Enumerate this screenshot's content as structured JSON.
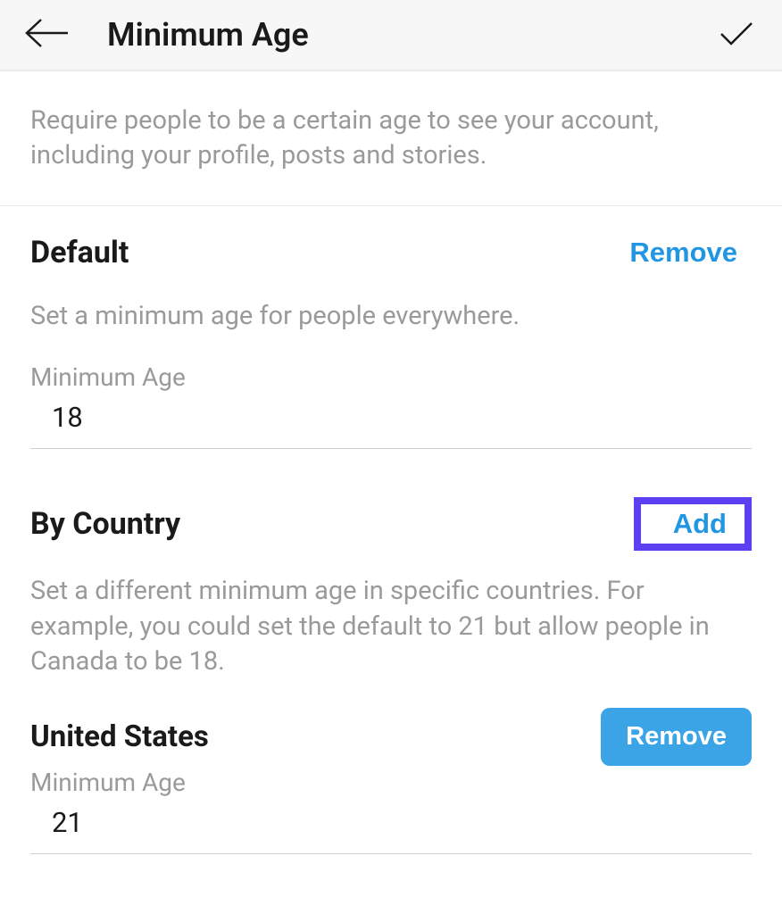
{
  "header": {
    "title": "Minimum Age"
  },
  "description": "Require people to be a certain age to see your account, including your profile, posts and stories.",
  "default_section": {
    "title": "Default",
    "remove_label": "Remove",
    "description": "Set a minimum age for people everywhere.",
    "field_label": "Minimum Age",
    "field_value": "18"
  },
  "by_country_section": {
    "title": "By Country",
    "add_label": "Add",
    "description": "Set a different minimum age in specific countries. For example, you could set the default to 21 but allow people in Canada to be 18.",
    "countries": [
      {
        "name": "United States",
        "remove_label": "Remove",
        "field_label": "Minimum Age",
        "field_value": "21"
      }
    ]
  }
}
